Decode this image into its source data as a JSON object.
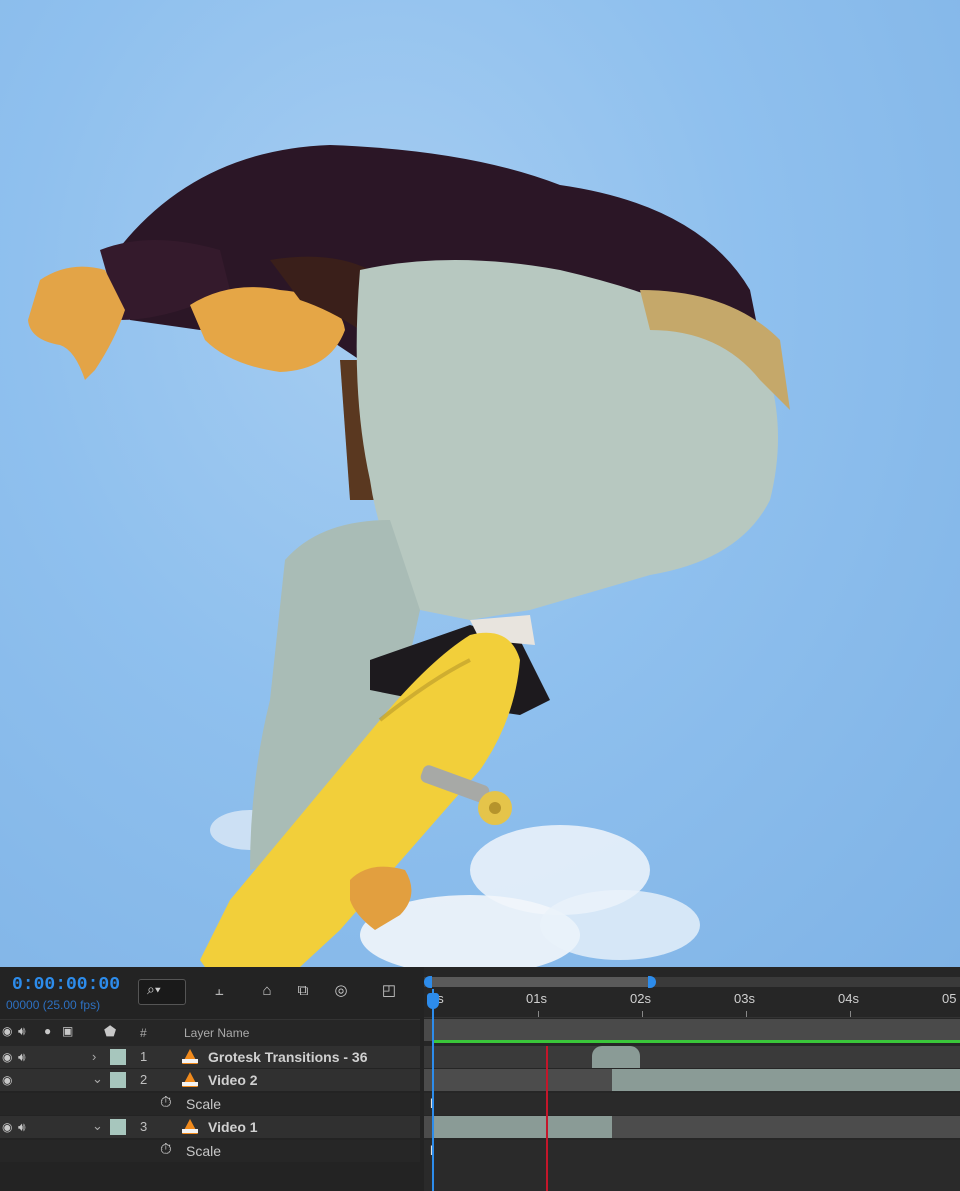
{
  "timeline": {
    "timecode": "0:00:00:00",
    "frames_fps": "00000 (25.00 fps)",
    "search_icon": "search-icon",
    "columns": {
      "number": "#",
      "layer_name": "Layer Name"
    },
    "ruler_ticks": [
      "0s",
      "01s",
      "02s",
      "03s",
      "04s",
      "05"
    ],
    "layers": [
      {
        "num": "1",
        "name": "Grotesk Transitions - 36",
        "expanded": false
      },
      {
        "num": "2",
        "name": "Video 2",
        "expanded": true,
        "property": "Scale"
      },
      {
        "num": "3",
        "name": "Video 1",
        "expanded": true,
        "property": "Scale"
      }
    ],
    "colors": {
      "timecode": "#2d8ceb",
      "playhead": "#2d8ceb",
      "work_area": "#3ac63a",
      "current_marker": "#c4162a",
      "label_swatch": "#a7c6bd",
      "layer_bar": "#8a9b96"
    }
  },
  "viewer": {
    "description_icon": "composition-frame"
  }
}
